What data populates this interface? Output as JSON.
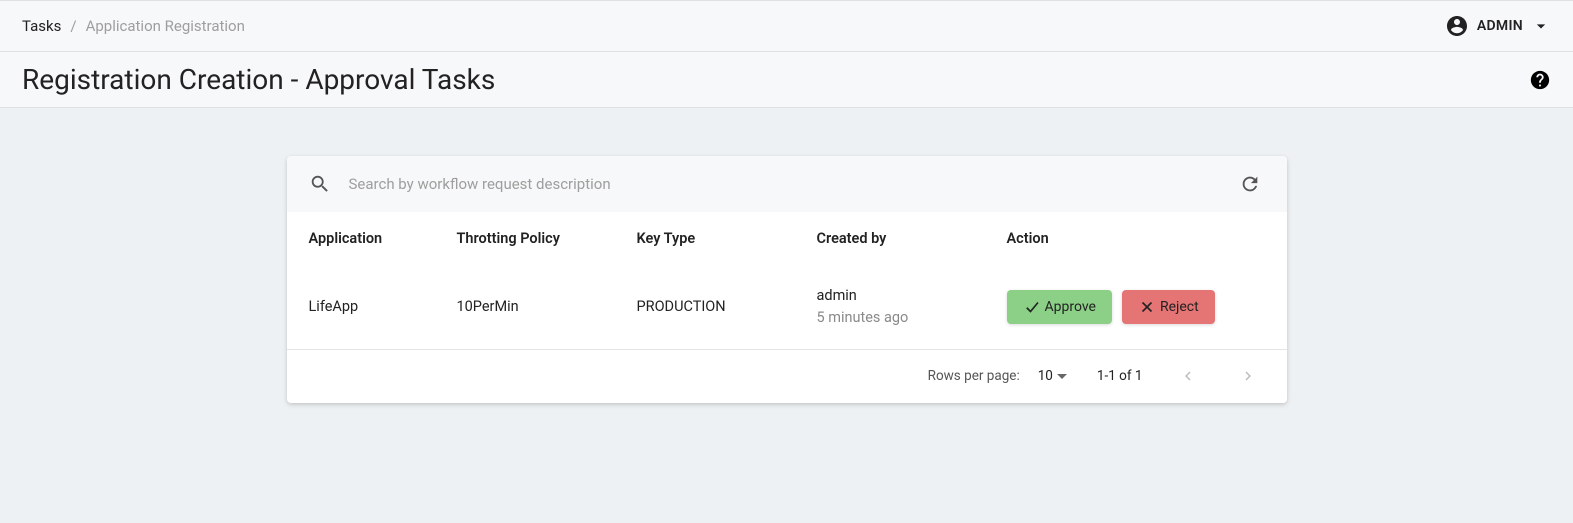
{
  "breadcrumb": {
    "root": "Tasks",
    "leaf": "Application Registration"
  },
  "user": {
    "name": "ADMIN"
  },
  "page": {
    "title": "Registration Creation - Approval Tasks"
  },
  "search": {
    "placeholder": "Search by workflow request description"
  },
  "table": {
    "columns": {
      "application": "Application",
      "throtting_policy": "Throtting Policy",
      "key_type": "Key Type",
      "created_by": "Created by",
      "action": "Action"
    },
    "rows": [
      {
        "application": "LifeApp",
        "throtting_policy": "10PerMin",
        "key_type": "PRODUCTION",
        "created_by": "admin",
        "created_when": "5 minutes ago"
      }
    ]
  },
  "actions": {
    "approve": "Approve",
    "reject": "Reject"
  },
  "pagination": {
    "rows_per_page_label": "Rows per page:",
    "rows_per_page_value": "10",
    "range": "1-1 of 1"
  }
}
